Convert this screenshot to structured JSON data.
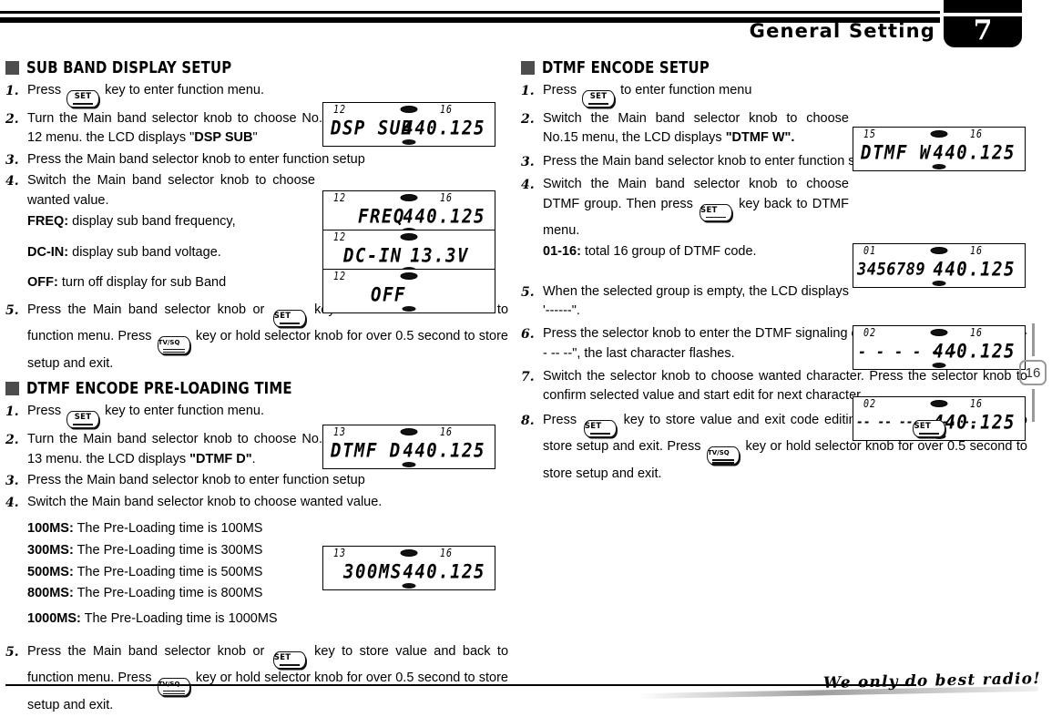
{
  "header": {
    "title": "General Setting",
    "chapter": "7"
  },
  "page_marker": {
    "number": "16"
  },
  "footer": {
    "tagline": "We only do best radio!"
  },
  "keys": {
    "set": "SET",
    "tvsq": "TV/SQ"
  },
  "left_column": {
    "section1": {
      "title": "SUB BAND DISPLAY SETUP",
      "steps": [
        {
          "num": "1.",
          "text": "Press @SET@ key to enter function menu."
        },
        {
          "num": "2.",
          "text": "Turn the Main band selector knob to choose No. 12 menu. the LCD displays \"DSP SUB\""
        },
        {
          "num": "3.",
          "text": "Press the Main band selector knob to enter function setup"
        },
        {
          "num": "4.",
          "text": "Switch the Main band selector knob to choose wanted value."
        },
        {
          "num": "5.",
          "text": "Press the Main band selector knob or @SET@ key to store value and back to function menu. Press @TVSQ@ key or hold selector knob for over 0.5 second to store setup and exit."
        }
      ],
      "options": [
        {
          "label": "FREQ:",
          "desc": "display sub band frequency,"
        },
        {
          "label": "DC-IN:",
          "desc": "display sub band voltage."
        },
        {
          "label": "OFF:",
          "desc": "turn off display for sub Band"
        }
      ],
      "step2_bold": "DSP SUB",
      "lcds": [
        {
          "menu": "12",
          "band": "16",
          "left": "DSP SUB",
          "right": "440.125",
          "align": "split"
        },
        {
          "menu": "12",
          "band": "16",
          "left": "FREQ",
          "right": "440.125",
          "align": "split"
        },
        {
          "menu": "12",
          "band": "",
          "left": "DC-IN",
          "right": "13.3V",
          "align": "split"
        },
        {
          "menu": "12",
          "band": "",
          "left": "OFF",
          "right": "",
          "align": "center"
        }
      ]
    },
    "section2": {
      "title": "DTMF ENCODE PRE-LOADING TIME",
      "steps": [
        {
          "num": "1.",
          "text": "Press @SET@ key to enter function menu."
        },
        {
          "num": "2.",
          "text": "Turn the Main band selector knob to choose No. 13 menu. the LCD displays \"DTMF D\"."
        },
        {
          "num": "3.",
          "text": "Press the Main band selector knob to enter function setup"
        },
        {
          "num": "4.",
          "text": "Switch the Main band selector knob to choose wanted value."
        },
        {
          "num": "5.",
          "text": "Press the Main band selector knob or @SET@ key to store value and back to function menu. Press @TVSQ@ key or hold selector knob for over 0.5 second to store setup and exit."
        }
      ],
      "options": [
        {
          "label": "100MS:",
          "desc": "The Pre-Loading time is 100MS"
        },
        {
          "label": "300MS:",
          "desc": "The Pre-Loading time is 300MS"
        },
        {
          "label": "500MS:",
          "desc": "The Pre-Loading time is 500MS"
        },
        {
          "label": "800MS:",
          "desc": "The Pre-Loading time is 800MS"
        },
        {
          "label": "1000MS:",
          "desc": "The Pre-Loading time is 1000MS"
        }
      ],
      "lcds": [
        {
          "menu": "13",
          "band": "16",
          "left": "DTMF D",
          "right": "440.125"
        },
        {
          "menu": "13",
          "band": "16",
          "left": "300MS",
          "right": "440.125"
        }
      ]
    }
  },
  "right_column": {
    "section1": {
      "title": "DTMF ENCODE SETUP",
      "steps": [
        {
          "num": "1.",
          "text": "Press @SET@  to enter function menu"
        },
        {
          "num": "2.",
          "text": "Switch the Main band selector knob to choose No.15 menu, the LCD displays \"DTMF W\"."
        },
        {
          "num": "3.",
          "text": "Press the Main band selector knob to enter function setup."
        },
        {
          "num": "4.",
          "text": "Switch the Main band selector knob to choose DTMF group. Then press @SET@ key back to DTMF menu."
        },
        {
          "num": "5.",
          "text": "When the selected group is empty, the LCD displays '------\"."
        },
        {
          "num": "6.",
          "text": "Press the selector knob to enter the DTMF signaling edit. The LCD display \"-- -- -- -- -- --\", the last character flashes."
        },
        {
          "num": "7.",
          "text": "Switch the selector knob to choose wanted character. Press the selector knob to confirm selected value and start edit for next character."
        },
        {
          "num": "8.",
          "text": "Press @SET@ key to store value and exit code editing. Press @SET@ key again to store setup and exit. Press @TVSQ@ key or hold selector knob for over 0.5 second to store setup and exit."
        }
      ],
      "options": [
        {
          "label": "01-16:",
          "desc": " total 16 group of DTMF code."
        }
      ],
      "lcds": [
        {
          "menu": "15",
          "band": "16",
          "left": "DTMF W",
          "right": "440.125"
        },
        {
          "menu": "01",
          "band": "16",
          "left": "3456789",
          "right": "440.125"
        },
        {
          "menu": "02",
          "band": "16",
          "left": "- - - - - -",
          "right": "440.125"
        },
        {
          "menu": "02",
          "band": "16",
          "left": "-- -- -- -- -- --",
          "right": "440.125"
        }
      ]
    }
  }
}
